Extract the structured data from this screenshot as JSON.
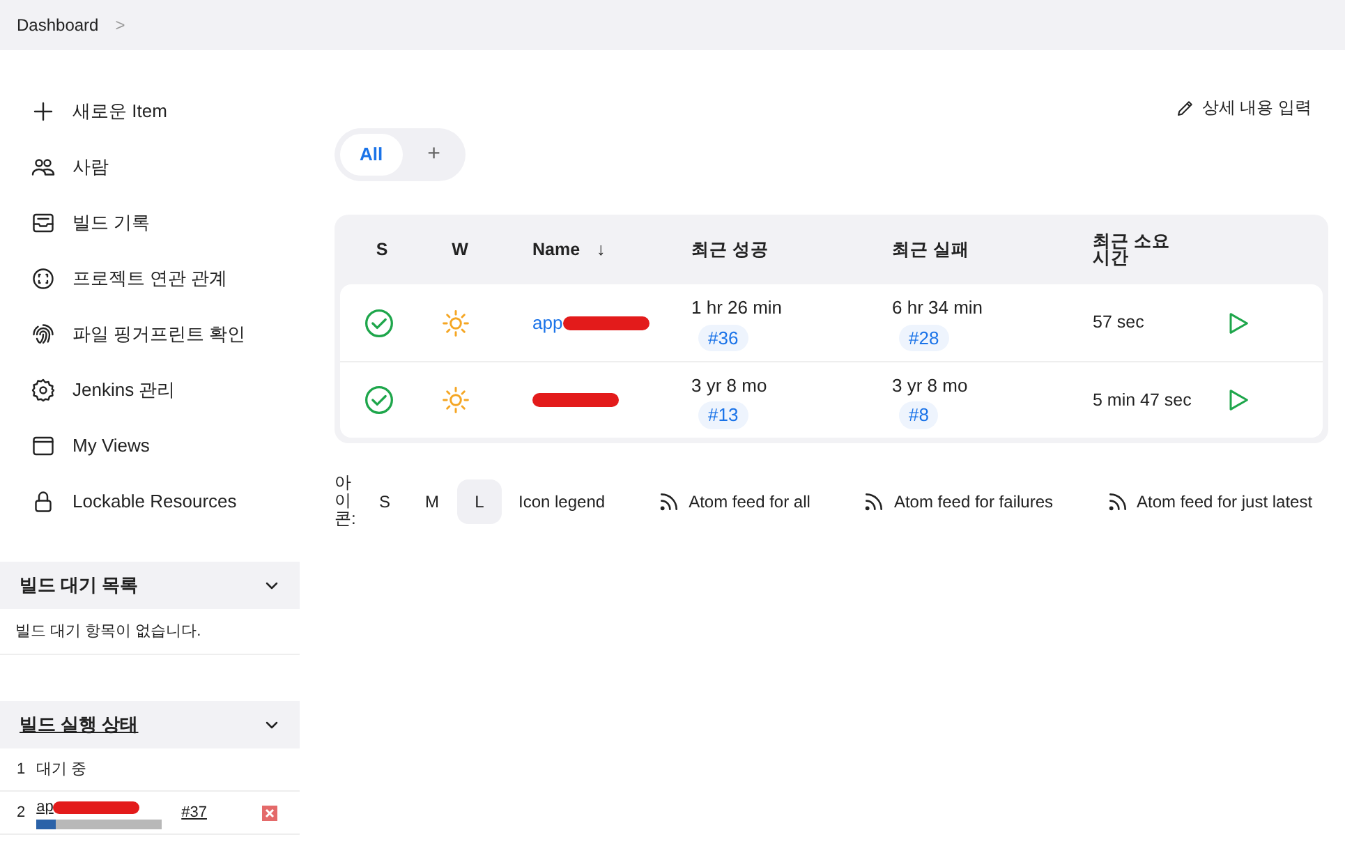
{
  "breadcrumb": {
    "items": [
      "Dashboard"
    ],
    "separator": ">"
  },
  "sidebar": {
    "items": [
      {
        "kind": "plus",
        "label": "새로운 Item"
      },
      {
        "kind": "people",
        "label": "사람"
      },
      {
        "kind": "inbox",
        "label": "빌드 기록"
      },
      {
        "kind": "relation",
        "label": "프로젝트 연관 관계"
      },
      {
        "kind": "fingerprint",
        "label": "파일 핑거프린트 확인"
      },
      {
        "kind": "gear",
        "label": "Jenkins 관리"
      },
      {
        "kind": "window",
        "label": "My Views"
      },
      {
        "kind": "lock",
        "label": "Lockable Resources"
      }
    ]
  },
  "build_queue": {
    "title": "빌드 대기 목록",
    "expanded": true,
    "empty_text": "빌드 대기 항목이 없습니다."
  },
  "executors": {
    "title": "빌드 실행 상태",
    "expanded": true,
    "rows": [
      {
        "kind": "idle",
        "number": "1",
        "label": "대기 중"
      },
      {
        "kind": "busy",
        "number": "2",
        "label": "ap",
        "build": "#37",
        "level": 0.15
      }
    ]
  },
  "edit_description": "상세 내용 입력",
  "view_tabs": [
    {
      "label": "All",
      "selected": true
    },
    {
      "label": "+",
      "selected": false
    }
  ],
  "table": {
    "columns": [
      "S",
      "W",
      "Name",
      "최근 성공",
      "최근 실패",
      "최근 소요 시간"
    ],
    "sort_arrow": "↓",
    "rows": [
      {
        "success": true,
        "sunny": true,
        "name": "app",
        "last_success": "1 hr 26 min",
        "success_build": "#36",
        "last_failure": "6 hr 34 min",
        "failure_build": "#28",
        "duration": "57 sec"
      },
      {
        "success": true,
        "sunny": true,
        "last_success": "3 yr 8 mo",
        "success_build": "#13",
        "last_failure": "3 yr 8 mo",
        "failure_build": "#8",
        "duration": "5 min 47 sec"
      }
    ]
  },
  "footer": {
    "icon_label": "아이콘:",
    "sizes": [
      {
        "label": "S",
        "selected": false
      },
      {
        "label": "M",
        "selected": false
      },
      {
        "label": "L",
        "selected": true
      }
    ],
    "legend": "Icon legend",
    "feeds": [
      "Atom feed for all",
      "Atom feed for failures",
      "Atom feed for just latest"
    ]
  }
}
